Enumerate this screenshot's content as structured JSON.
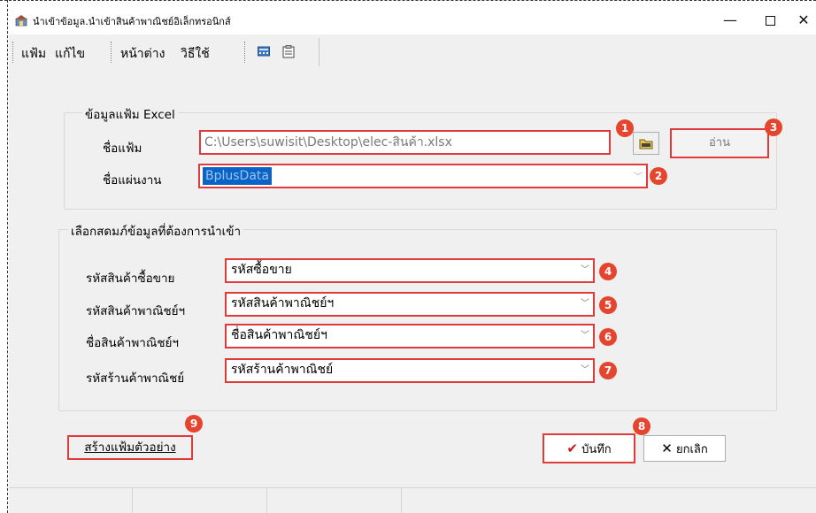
{
  "window": {
    "title": "นำเข้าข้อมูล.นำเข้าสินค้าพาณิชย์อิเล็กทรอนิกส์",
    "controls": {
      "minimize": "—",
      "close": "✕"
    }
  },
  "menu": {
    "items": [
      "แฟ้ม",
      "แก้ไข",
      "หน้าต่าง",
      "วิธีใช้"
    ],
    "toolbar_icons": [
      "calculator-icon",
      "clipboard-icon"
    ]
  },
  "excel_group": {
    "title": "ข้อมูลแฟ้ม Excel",
    "file_label": "ชื่อแฟ้ม",
    "file_value": "C:\\Users\\suwisit\\Desktop\\elec-สินค้า.xlsx",
    "sheet_label": "ชื่อแผ่นงาน",
    "sheet_value": "BplusData",
    "read_button": "อ่าน"
  },
  "fields_group": {
    "title": "เลือกสดมภ์ข้อมูลที่ต้องการนำเข้า",
    "rows": [
      {
        "label": "รหัสสินค้าซื้อขาย",
        "value": "รหัสซื้อขาย"
      },
      {
        "label": "รหัสสินค้าพาณิชย์ฯ",
        "value": "รหัสสินค้าพาณิชย์ฯ"
      },
      {
        "label": "ชื่อสินค้าพาณิชย์ฯ",
        "value": "ชื่อสินค้าพาณิชย์ฯ"
      },
      {
        "label": "รหัสร้านค้าพาณิชย์",
        "value": "รหัสร้านค้าพาณิชย์"
      }
    ]
  },
  "actions": {
    "create_sample": "สร้างแฟ้มตัวอย่าง",
    "save": "บันทึก",
    "cancel": "ยกเลิก"
  },
  "badges": [
    "1",
    "2",
    "3",
    "4",
    "5",
    "6",
    "7",
    "8",
    "9"
  ],
  "colors": {
    "highlight_border": "#e03a3a",
    "badge": "#e5452e",
    "selection": "#0a64c8",
    "window_bg": "#f0f0f0"
  }
}
